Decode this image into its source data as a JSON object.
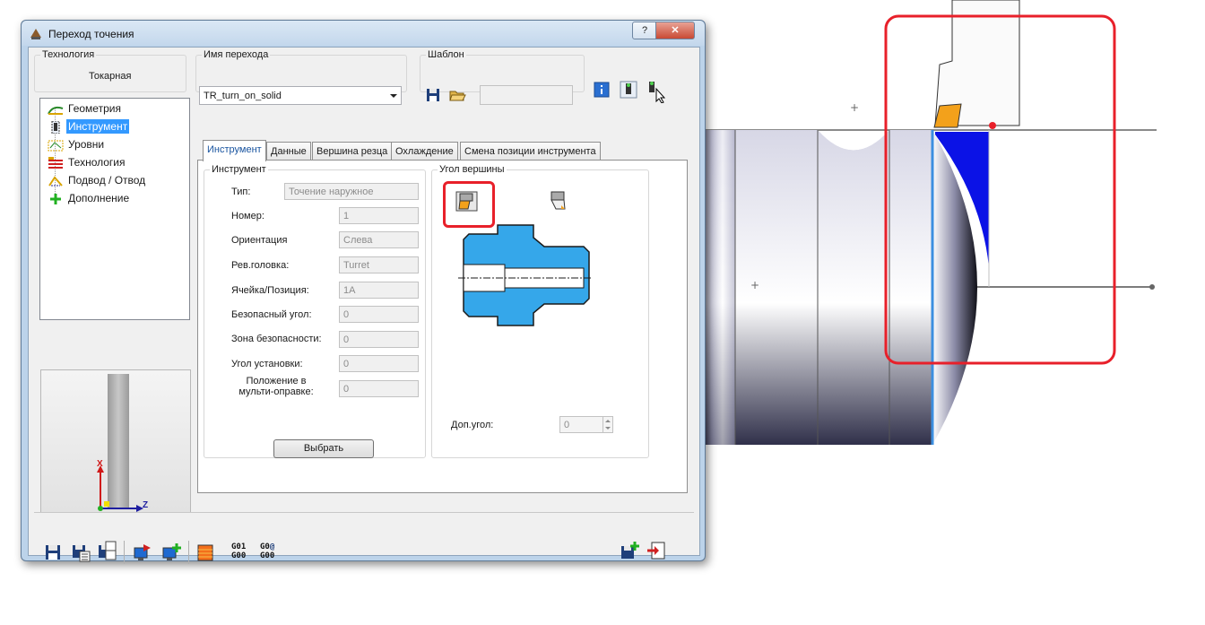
{
  "window": {
    "title": "Переход точения",
    "help_label": "?",
    "close_label": "✕"
  },
  "technology": {
    "legend": "Технология",
    "value": "Токарная"
  },
  "transition_name": {
    "legend": "Имя перехода",
    "value": "TR_turn_on_solid"
  },
  "template": {
    "legend": "Шаблон",
    "value": ""
  },
  "tree": {
    "items": [
      {
        "label": "Геометрия",
        "icon": "geometry-icon"
      },
      {
        "label": "Инструмент",
        "icon": "tool-icon",
        "selected": true
      },
      {
        "label": "Уровни",
        "icon": "levels-icon"
      },
      {
        "label": "Технология",
        "icon": "technology-icon"
      },
      {
        "label": "Подвод / Отвод",
        "icon": "approach-retract-icon"
      },
      {
        "label": "Дополнение",
        "icon": "add-icon"
      }
    ]
  },
  "preview": {
    "axis_x": "X",
    "axis_z": "Z"
  },
  "tabs": [
    {
      "label": "Инструмент",
      "active": true
    },
    {
      "label": "Данные"
    },
    {
      "label": "Вершина резца"
    },
    {
      "label": "Охлаждение"
    },
    {
      "label": "Смена позиции инструмента"
    }
  ],
  "tool_group": {
    "legend": "Инструмент",
    "fields": [
      {
        "label": "Тип:",
        "value": "Точение наружное"
      },
      {
        "label": "Номер:",
        "value": "1"
      },
      {
        "label": "Ориентация",
        "value": "Слева"
      },
      {
        "label": "Рев.головка:",
        "value": "Turret"
      },
      {
        "label": "Ячейка/Позиция:",
        "value": "1A"
      },
      {
        "label": "Безопасный угол:",
        "value": "0"
      },
      {
        "label": "Зона безопасности:",
        "value": "0"
      },
      {
        "label": "Угол установки:",
        "value": "0"
      },
      {
        "label": "Положение в мульти-оправке:",
        "value": "0"
      }
    ],
    "select_button": "Выбрать"
  },
  "vertex_group": {
    "legend": "Угол вершины",
    "extra_angle_label": "Доп.угол:",
    "extra_angle_value": "0"
  },
  "bottom_toolbar": {
    "gcode_left": [
      "G01",
      "G00"
    ],
    "gcode_right": [
      "G0",
      "G00"
    ]
  },
  "colors": {
    "accent": "#3399ff",
    "highlight": "#e8202a",
    "part_blue": "#35a7ea"
  }
}
